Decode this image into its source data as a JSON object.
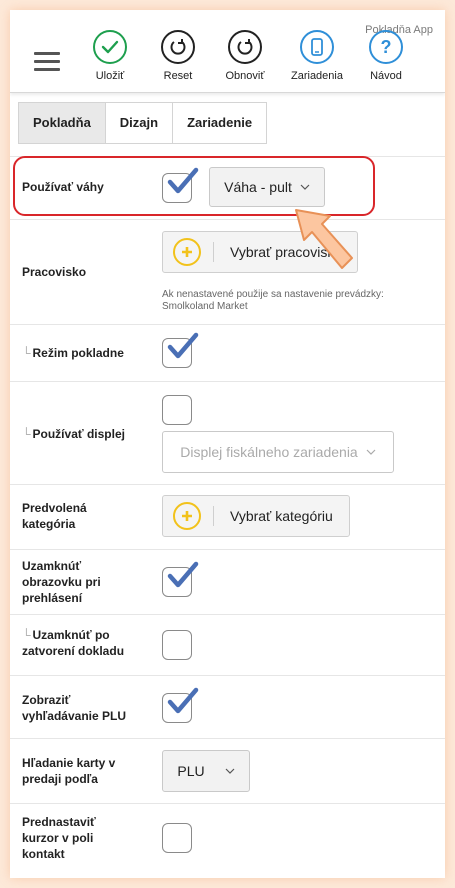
{
  "app": {
    "title": "Pokladňa App"
  },
  "toolbar": {
    "save_label": "Uložiť",
    "reset_label": "Reset",
    "refresh_label": "Obnoviť",
    "devices_label": "Zariadenia",
    "guide_label": "Návod"
  },
  "tabs": [
    {
      "label": "Pokladňa",
      "active": true
    },
    {
      "label": "Dizajn",
      "active": false
    },
    {
      "label": "Zariadenie",
      "active": false
    }
  ],
  "settings": {
    "use_scales": {
      "label": "Používať váhy",
      "checked": true,
      "select_value": "Váha - pult"
    },
    "workplace": {
      "label": "Pracovisko",
      "button": "Vybrať pracovisko",
      "hint_line1": "Ak nenastavené použije sa nastavenie prevádzky:",
      "hint_line2": "Smolkoland Market"
    },
    "cash_mode": {
      "label": "Režim pokladne",
      "checked": true
    },
    "use_display": {
      "label": "Používať displej",
      "checked": false,
      "select_value": "Displej fiskálneho zariadenia"
    },
    "default_category": {
      "label_line1": "Predvolená",
      "label_line2": "kategória",
      "button": "Vybrať kategóriu"
    },
    "lock_screen": {
      "label_line1": "Uzamknúť",
      "label_line2": "obrazovku pri",
      "label_line3": "prehlásení",
      "checked": true
    },
    "lock_after_doc": {
      "label_line1": "Uzamknúť po",
      "label_line2": "zatvorení dokladu",
      "checked": false
    },
    "show_plu_search": {
      "label_line1": "Zobraziť",
      "label_line2": "vyhľadávanie PLU",
      "checked": true
    },
    "card_search": {
      "label_line1": "Hľadanie karty v",
      "label_line2": "predaji podľa",
      "select_value": "PLU"
    },
    "cursor_contact": {
      "label_line1": "Prednastaviť",
      "label_line2": "kurzor v poli",
      "label_line3": "kontakt",
      "checked": false
    }
  },
  "colors": {
    "accent_red": "#d9262a",
    "check_blue": "#4a6fb5",
    "save_green": "#1e9f4e",
    "device_blue": "#2f8fd8",
    "plus_yellow": "#f2c21b"
  }
}
